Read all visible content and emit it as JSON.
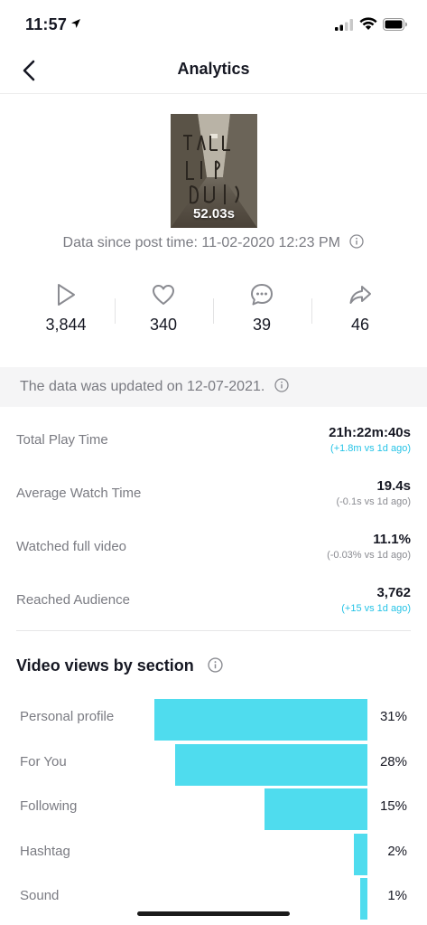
{
  "status_bar": {
    "time": "11:57"
  },
  "nav": {
    "title": "Analytics"
  },
  "video": {
    "duration": "52.03s",
    "since_text": "Data since post time: 11-02-2020 12:23 PM"
  },
  "stats": [
    {
      "icon": "play-icon",
      "value": "3,844"
    },
    {
      "icon": "heart-icon",
      "value": "340"
    },
    {
      "icon": "comment-icon",
      "value": "39"
    },
    {
      "icon": "share-icon",
      "value": "46"
    }
  ],
  "updated_text": "The data was updated on 12-07-2021.",
  "metrics": [
    {
      "label": "Total Play Time",
      "value": "21h:22m:40s",
      "delta": "(+1.8m vs 1d ago)",
      "delta_color": "#25c3e6"
    },
    {
      "label": "Average Watch Time",
      "value": "19.4s",
      "delta": "(-0.1s vs 1d ago)",
      "delta_color": "#8a8b91"
    },
    {
      "label": "Watched full video",
      "value": "11.1%",
      "delta": "(-0.03% vs 1d ago)",
      "delta_color": "#8a8b91"
    },
    {
      "label": "Reached Audience",
      "value": "3,762",
      "delta": "(+15 vs 1d ago)",
      "delta_color": "#25c3e6"
    }
  ],
  "views_section": {
    "title": "Video views by section"
  },
  "chart_data": {
    "type": "bar",
    "categories": [
      "Personal profile",
      "For You",
      "Following",
      "Hashtag",
      "Sound"
    ],
    "values": [
      31,
      28,
      15,
      2,
      1
    ],
    "value_labels": [
      "31%",
      "28%",
      "15%",
      "2%",
      "1%"
    ],
    "bar_color": "#4fdcee"
  }
}
